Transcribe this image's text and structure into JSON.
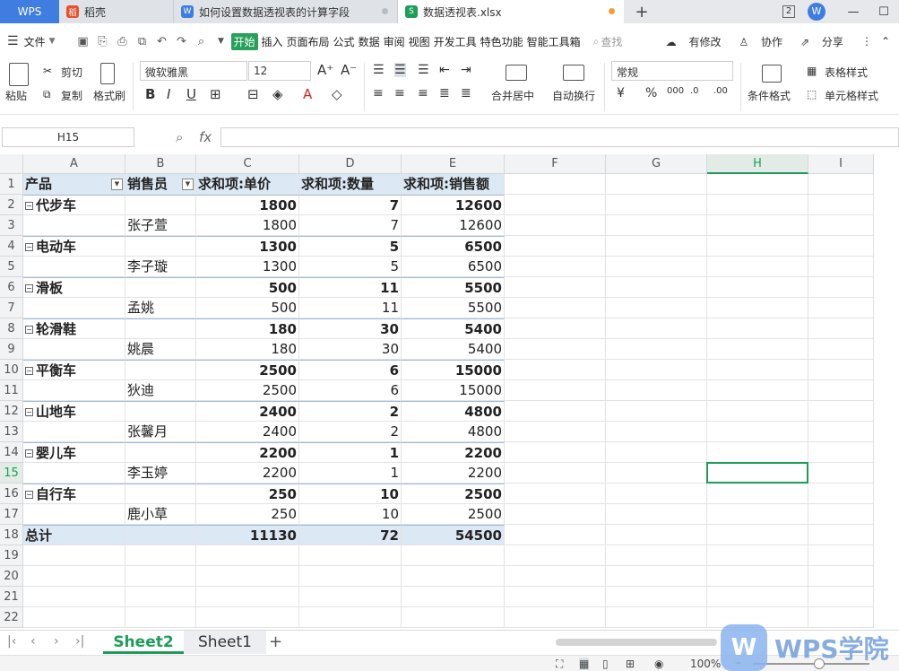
{
  "tabs": {
    "wps": "WPS",
    "doc": "稻壳",
    "article": "如何设置数据透视表的计算字段",
    "sheet": "数据透视表.xlsx",
    "add": "+"
  },
  "window": {
    "badge": "2",
    "minimize": "—",
    "restore": "☐"
  },
  "menu": {
    "file": "文件",
    "items": [
      "开始",
      "插入",
      "页面布局",
      "公式",
      "数据",
      "审阅",
      "视图",
      "开发工具",
      "特色功能",
      "智能工具箱"
    ],
    "search": "查找",
    "changes": "有修改",
    "collab": "协作",
    "share": "分享"
  },
  "ribbon": {
    "paste": "粘贴",
    "cut": "剪切",
    "copy": "复制",
    "format_painter": "格式刷",
    "font_name": "微软雅黑",
    "font_size": "12",
    "merge": "合并居中",
    "wrap": "自动换行",
    "number_format": "常规",
    "cond_format": "条件格式",
    "table_style": "表格样式",
    "cell_style": "单元格样式"
  },
  "formula": {
    "name_box": "H15",
    "fx": "fx"
  },
  "columns": [
    "A",
    "B",
    "C",
    "D",
    "E",
    "F",
    "G",
    "H",
    "I"
  ],
  "rows": [
    "1",
    "2",
    "3",
    "4",
    "5",
    "6",
    "7",
    "8",
    "9",
    "10",
    "11",
    "12",
    "13",
    "14",
    "15",
    "16",
    "17",
    "18",
    "19",
    "20",
    "21",
    "22"
  ],
  "pivot": {
    "headers": [
      "产品",
      "销售员",
      "求和项:单价",
      "求和项:数量",
      "求和项:销售额"
    ],
    "rows": [
      {
        "a": "代步车",
        "b": "",
        "c": "1800",
        "d": "7",
        "e": "12600",
        "group": true
      },
      {
        "a": "",
        "b": "张子萱",
        "c": "1800",
        "d": "7",
        "e": "12600",
        "group": false
      },
      {
        "a": "电动车",
        "b": "",
        "c": "1300",
        "d": "5",
        "e": "6500",
        "group": true
      },
      {
        "a": "",
        "b": "李子璇",
        "c": "1300",
        "d": "5",
        "e": "6500",
        "group": false
      },
      {
        "a": "滑板",
        "b": "",
        "c": "500",
        "d": "11",
        "e": "5500",
        "group": true
      },
      {
        "a": "",
        "b": "孟姚",
        "c": "500",
        "d": "11",
        "e": "5500",
        "group": false
      },
      {
        "a": "轮滑鞋",
        "b": "",
        "c": "180",
        "d": "30",
        "e": "5400",
        "group": true
      },
      {
        "a": "",
        "b": "姚晨",
        "c": "180",
        "d": "30",
        "e": "5400",
        "group": false
      },
      {
        "a": "平衡车",
        "b": "",
        "c": "2500",
        "d": "6",
        "e": "15000",
        "group": true
      },
      {
        "a": "",
        "b": "狄迪",
        "c": "2500",
        "d": "6",
        "e": "15000",
        "group": false
      },
      {
        "a": "山地车",
        "b": "",
        "c": "2400",
        "d": "2",
        "e": "4800",
        "group": true
      },
      {
        "a": "",
        "b": "张馨月",
        "c": "2400",
        "d": "2",
        "e": "4800",
        "group": false
      },
      {
        "a": "婴儿车",
        "b": "",
        "c": "2200",
        "d": "1",
        "e": "2200",
        "group": true
      },
      {
        "a": "",
        "b": "李玉婷",
        "c": "2200",
        "d": "1",
        "e": "2200",
        "group": false
      },
      {
        "a": "自行车",
        "b": "",
        "c": "250",
        "d": "10",
        "e": "2500",
        "group": true
      },
      {
        "a": "",
        "b": "鹿小草",
        "c": "250",
        "d": "10",
        "e": "2500",
        "group": false
      }
    ],
    "total": {
      "a": "总计",
      "c": "11130",
      "d": "72",
      "e": "54500"
    }
  },
  "selected_cell": {
    "col": "H",
    "row": "15"
  },
  "sheets": [
    "Sheet2",
    "Sheet1"
  ],
  "active_sheet": "Sheet2",
  "status": {
    "zoom": "100%"
  },
  "watermark": {
    "mark": "W",
    "text": "WPS学院"
  },
  "colors": {
    "accent": "#1e9d5a",
    "pivot_header": "#dde8f5",
    "tab_blue": "#3f7ee0"
  }
}
